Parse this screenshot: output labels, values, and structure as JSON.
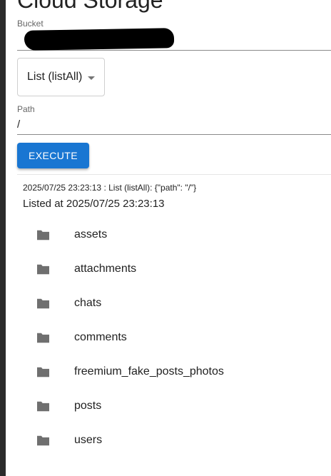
{
  "page": {
    "title": "Cloud Storage"
  },
  "bucket": {
    "label": "Bucket",
    "value": ""
  },
  "operation": {
    "selected": "List (listAll)"
  },
  "path": {
    "label": "Path",
    "value": "/"
  },
  "actions": {
    "execute_label": "EXECUTE"
  },
  "result": {
    "log": "2025/07/25 23:23:13 : List (listAll): {\"path\": \"/\"}",
    "listed": "Listed at 2025/07/25 23:23:13",
    "items": [
      {
        "name": "assets",
        "icon": "folder-icon"
      },
      {
        "name": "attachments",
        "icon": "folder-icon"
      },
      {
        "name": "chats",
        "icon": "folder-icon"
      },
      {
        "name": "comments",
        "icon": "folder-icon"
      },
      {
        "name": "freemium_fake_posts_photos",
        "icon": "folder-icon"
      },
      {
        "name": "posts",
        "icon": "folder-icon"
      },
      {
        "name": "users",
        "icon": "folder-icon"
      }
    ]
  },
  "colors": {
    "primary": "#1976d2",
    "folder": "#6f6f6f"
  }
}
